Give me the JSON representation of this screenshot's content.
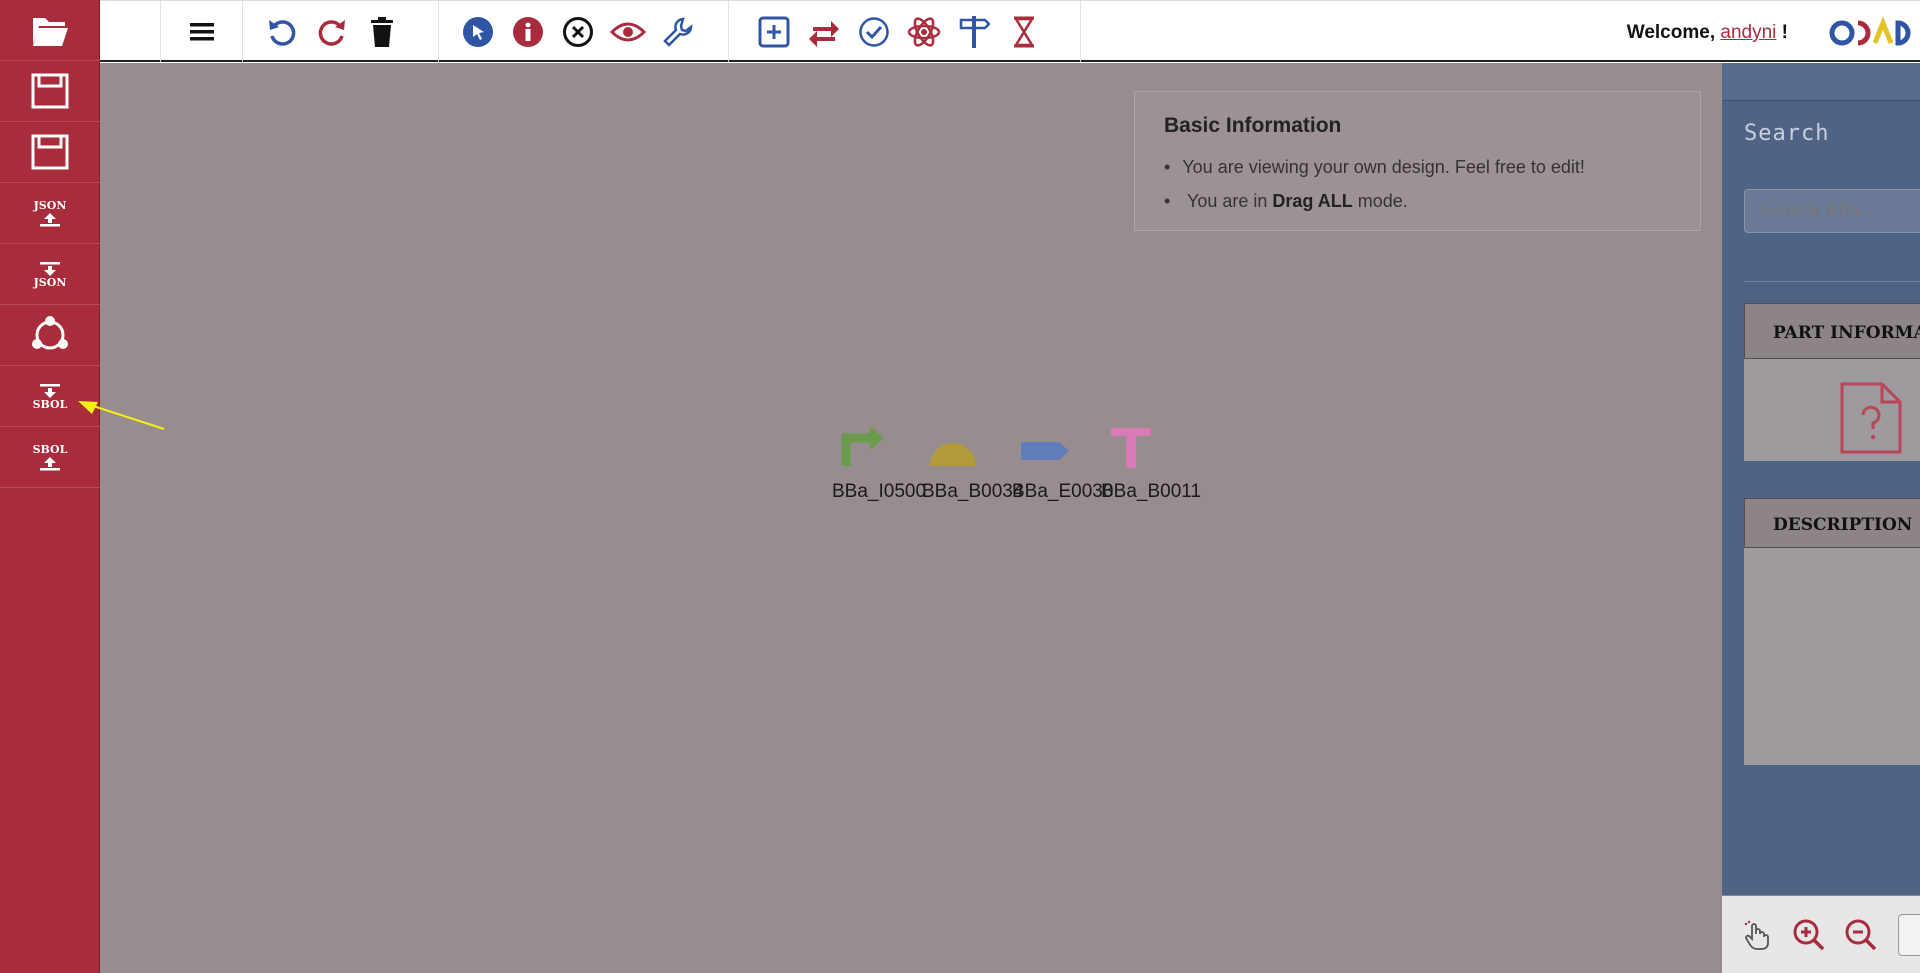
{
  "sidebar": {
    "items": [
      {
        "name": "open-folder",
        "label": ""
      },
      {
        "name": "save",
        "label": ""
      },
      {
        "name": "save-as",
        "label": ""
      },
      {
        "name": "export-json",
        "label": "JSON"
      },
      {
        "name": "import-json",
        "label": "JSON"
      },
      {
        "name": "share",
        "label": ""
      },
      {
        "name": "import-sbol",
        "label": "SBOL"
      },
      {
        "name": "export-sbol",
        "label": "SBOL"
      }
    ]
  },
  "header": {
    "welcome_prefix": "Welcome,",
    "username": "andyni",
    "welcome_suffix": "!"
  },
  "info": {
    "title": "Basic Information",
    "line1": "You are viewing your own design. Feel free to edit!",
    "line2_prefix": "You are in",
    "line2_bold": "Drag ALL",
    "line2_suffix": "mode."
  },
  "design": {
    "parts": [
      {
        "label": "BBa_I0500",
        "type": "promoter",
        "color": "#6a9a4c"
      },
      {
        "label": "BBa_B0034",
        "type": "rbs",
        "color": "#b49a3a"
      },
      {
        "label": "BBa_E0030",
        "type": "cds",
        "color": "#5f7db9"
      },
      {
        "label": "BBa_B0011",
        "type": "terminator",
        "color": "#d97ab6"
      }
    ]
  },
  "right_panel": {
    "search_title": "Search",
    "search_placeholder": "Search BBa...",
    "part_info_header": "PART INFORMATION",
    "description_header": "DESCRIPTION"
  },
  "colors": {
    "brand_red": "#a82c3c",
    "brand_blue": "#2f55a4",
    "canvas_dim": "#978c8e",
    "panel_blue": "#4f6385"
  }
}
